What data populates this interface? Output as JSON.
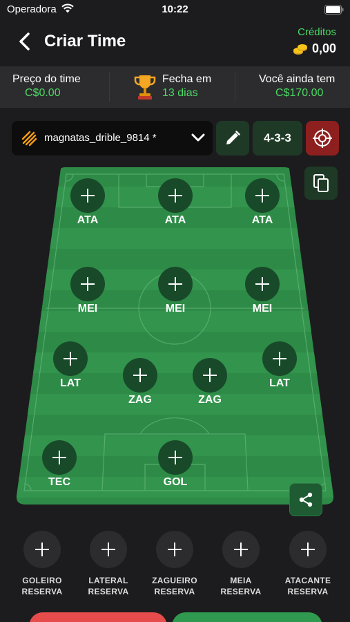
{
  "status": {
    "carrier": "Operadora",
    "time": "10:22"
  },
  "nav": {
    "title": "Criar Time",
    "credits_label": "Créditos",
    "credits_value": "0,00"
  },
  "info": {
    "price_label": "Preço do time",
    "price_value": "C$0.00",
    "close_label": "Fecha em",
    "close_value": "13 dias",
    "remaining_label": "Você ainda tem",
    "remaining_value": "C$170.00"
  },
  "team": {
    "name": "magnatas_drible_9814 *",
    "formation": "4-3-3"
  },
  "positions": {
    "ata1": "ATA",
    "ata2": "ATA",
    "ata3": "ATA",
    "mei1": "MEI",
    "mei2": "MEI",
    "mei3": "MEI",
    "lat1": "LAT",
    "zag1": "ZAG",
    "zag2": "ZAG",
    "lat2": "LAT",
    "tec": "TEC",
    "gol": "GOL"
  },
  "reserves": [
    {
      "line1": "GOLEIRO",
      "line2": "RESERVA"
    },
    {
      "line1": "LATERAL",
      "line2": "RESERVA"
    },
    {
      "line1": "ZAGUEIRO",
      "line2": "RESERVA"
    },
    {
      "line1": "MEIA",
      "line2": "RESERVA"
    },
    {
      "line1": "ATACANTE",
      "line2": "RESERVA"
    }
  ],
  "colors": {
    "accent_green": "#4cd964",
    "field_green": "#2e8b47",
    "danger_red": "#e74c4c"
  },
  "icons": [
    "wifi-icon",
    "battery-icon",
    "back-icon",
    "coins-icon",
    "trophy-icon",
    "team-logo-icon",
    "chevron-down-icon",
    "pencil-icon",
    "target-icon",
    "copy-icon",
    "share-icon",
    "plus-icon"
  ]
}
